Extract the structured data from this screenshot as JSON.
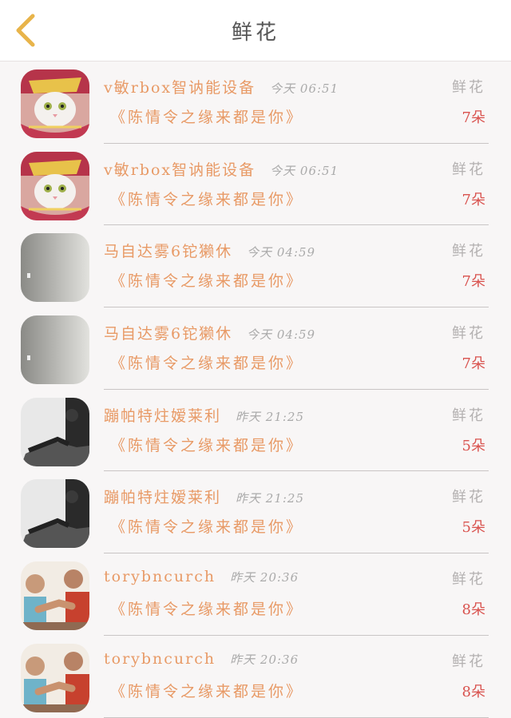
{
  "header": {
    "title": "鲜花",
    "back_icon": "chevron-left-icon",
    "back_color": "#e8b44a"
  },
  "rows": [
    {
      "name": "v敏rbox智讷能设备",
      "time": "今天 06:51",
      "gift": "鲜花",
      "book": "《陈情令之缘来都是你》",
      "count": "7朵",
      "avatar": "cat-avatar"
    },
    {
      "name": "v敏rbox智讷能设备",
      "time": "今天 06:51",
      "gift": "鲜花",
      "book": "《陈情令之缘来都是你》",
      "count": "7朵",
      "avatar": "cat-avatar"
    },
    {
      "name": "马自达雾6铊獭休",
      "time": "今天 04:59",
      "gift": "鲜花",
      "book": "《陈情令之缘来都是你》",
      "count": "7朵",
      "avatar": "gray-avatar"
    },
    {
      "name": "马自达雾6铊獭休",
      "time": "今天 04:59",
      "gift": "鲜花",
      "book": "《陈情令之缘来都是你》",
      "count": "7朵",
      "avatar": "gray-avatar"
    },
    {
      "name": "蹦帕特炷嫒莱利",
      "time": "昨天 21:25",
      "gift": "鲜花",
      "book": "《陈情令之缘来都是你》",
      "count": "5朵",
      "avatar": "bw-photo-avatar"
    },
    {
      "name": "蹦帕特炷嫒莱利",
      "time": "昨天 21:25",
      "gift": "鲜花",
      "book": "《陈情令之缘来都是你》",
      "count": "5朵",
      "avatar": "bw-photo-avatar"
    },
    {
      "name": "torybncurch",
      "time": "昨天 20:36",
      "gift": "鲜花",
      "book": "《陈情令之缘来都是你》",
      "count": "8朵",
      "avatar": "armwrestle-avatar"
    },
    {
      "name": "torybncurch",
      "time": "昨天 20:36",
      "gift": "鲜花",
      "book": "《陈情令之缘来都是你》",
      "count": "8朵",
      "avatar": "armwrestle-avatar"
    }
  ]
}
